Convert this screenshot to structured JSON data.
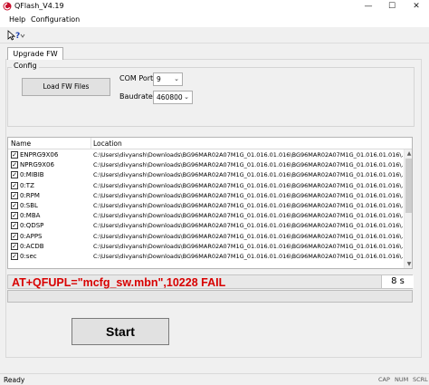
{
  "window": {
    "title": "QFlash_V4.19",
    "minimize_glyph": "—",
    "maximize_glyph": "☐",
    "close_glyph": "✕"
  },
  "menu": [
    "Help",
    "Configuration"
  ],
  "toolbar": {
    "icon": "help-pointer-icon"
  },
  "tabs": [
    "Upgrade FW"
  ],
  "config": {
    "legend": "Config",
    "load_button": "Load FW Files",
    "com_port_label": "COM Port:",
    "com_port_value": "9",
    "baudrate_label": "Baudrate:",
    "baudrate_value": "460800"
  },
  "file_table": {
    "headers": [
      "Name",
      "Location"
    ],
    "rows": [
      {
        "name": "ENPRG9X06",
        "checked": true,
        "location": "C:\\Users\\divyansh\\Downloads\\BG96MAR02A07M1G_01.016.01.016\\BG96MAR02A07M1G_01.016.01.016\\..."
      },
      {
        "name": "NPRG9X06",
        "checked": true,
        "location": "C:\\Users\\divyansh\\Downloads\\BG96MAR02A07M1G_01.016.01.016\\BG96MAR02A07M1G_01.016.01.016\\..."
      },
      {
        "name": "0:MIBIB",
        "checked": true,
        "location": "C:\\Users\\divyansh\\Downloads\\BG96MAR02A07M1G_01.016.01.016\\BG96MAR02A07M1G_01.016.01.016\\..."
      },
      {
        "name": "0:TZ",
        "checked": true,
        "location": "C:\\Users\\divyansh\\Downloads\\BG96MAR02A07M1G_01.016.01.016\\BG96MAR02A07M1G_01.016.01.016\\..."
      },
      {
        "name": "0:RPM",
        "checked": true,
        "location": "C:\\Users\\divyansh\\Downloads\\BG96MAR02A07M1G_01.016.01.016\\BG96MAR02A07M1G_01.016.01.016\\..."
      },
      {
        "name": "0:SBL",
        "checked": true,
        "location": "C:\\Users\\divyansh\\Downloads\\BG96MAR02A07M1G_01.016.01.016\\BG96MAR02A07M1G_01.016.01.016\\..."
      },
      {
        "name": "0:MBA",
        "checked": true,
        "location": "C:\\Users\\divyansh\\Downloads\\BG96MAR02A07M1G_01.016.01.016\\BG96MAR02A07M1G_01.016.01.016\\..."
      },
      {
        "name": "0:QDSP",
        "checked": true,
        "location": "C:\\Users\\divyansh\\Downloads\\BG96MAR02A07M1G_01.016.01.016\\BG96MAR02A07M1G_01.016.01.016\\..."
      },
      {
        "name": "0:APPS",
        "checked": true,
        "location": "C:\\Users\\divyansh\\Downloads\\BG96MAR02A07M1G_01.016.01.016\\BG96MAR02A07M1G_01.016.01.016\\..."
      },
      {
        "name": "0:ACDB",
        "checked": true,
        "location": "C:\\Users\\divyansh\\Downloads\\BG96MAR02A07M1G_01.016.01.016\\BG96MAR02A07M1G_01.016.01.016\\..."
      },
      {
        "name": "0:sec",
        "checked": true,
        "location": "C:\\Users\\divyansh\\Downloads\\BG96MAR02A07M1G_01.016.01.016\\BG96MAR02A07M1G_01.016.01.016\\..."
      }
    ]
  },
  "status": {
    "message": "AT+QFUPL=\"mcfg_sw.mbn\",10228   FAIL",
    "message_color": "#d80000",
    "timer": "8 s"
  },
  "progress": {
    "fraction": 0
  },
  "start_button": "Start",
  "statusbar": {
    "left": "Ready",
    "indicators": [
      "CAP",
      "NUM",
      "SCRL"
    ]
  }
}
